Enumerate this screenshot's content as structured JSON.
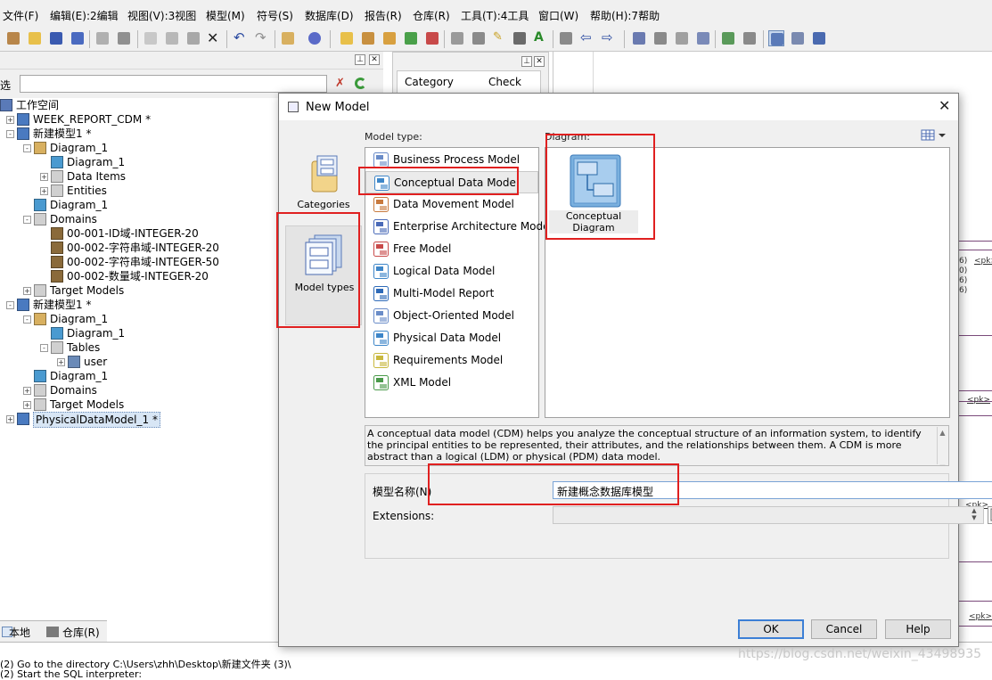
{
  "menu": [
    "文件(F)",
    "编辑(E):2编辑",
    "视图(V):3视图",
    "模型(M)",
    "符号(S)",
    "数据库(D)",
    "报告(R)",
    "仓库(R)",
    "工具(T):4工具",
    "窗口(W)",
    "帮助(H):7帮助"
  ],
  "browser": {
    "filter_label": "选",
    "tree": [
      {
        "label": "工作空间",
        "icon": "workspace-icon"
      },
      {
        "label": "WEEK_REPORT_CDM *",
        "icon": "model-icon"
      },
      {
        "label": "新建模型1 *",
        "icon": "model-icon"
      },
      {
        "label": "Diagram_1",
        "icon": "package-icon"
      },
      {
        "label": "Diagram_1",
        "icon": "diagram-icon"
      },
      {
        "label": "Data Items",
        "icon": "folder-icon"
      },
      {
        "label": "Entities",
        "icon": "folder-icon"
      },
      {
        "label": "Diagram_1",
        "icon": "diagram-icon"
      },
      {
        "label": "Domains",
        "icon": "folder-icon"
      },
      {
        "label": "00-001-ID域-INTEGER-20",
        "icon": "domain-icon"
      },
      {
        "label": "00-002-字符串域-INTEGER-20",
        "icon": "domain-icon"
      },
      {
        "label": "00-002-字符串域-INTEGER-50",
        "icon": "domain-icon"
      },
      {
        "label": "00-002-数量域-INTEGER-20",
        "icon": "domain-icon"
      },
      {
        "label": "Target Models",
        "icon": "folder-icon"
      },
      {
        "label": "新建模型1 *",
        "icon": "model-icon"
      },
      {
        "label": "Diagram_1",
        "icon": "package-icon"
      },
      {
        "label": "Diagram_1",
        "icon": "diagram-icon"
      },
      {
        "label": "Tables",
        "icon": "folder-icon"
      },
      {
        "label": "user",
        "icon": "table-icon"
      },
      {
        "label": "Diagram_1",
        "icon": "diagram-icon"
      },
      {
        "label": "Domains",
        "icon": "folder-icon"
      },
      {
        "label": "Target Models",
        "icon": "folder-icon"
      },
      {
        "label": "PhysicalDataModel_1 *",
        "icon": "model-icon"
      }
    ],
    "tabs": [
      "本地",
      "仓库(R)"
    ]
  },
  "midpanel": {
    "col1": "Category",
    "col2": "Check"
  },
  "output": [
    "(2) Go to the directory C:\\Users\\zhh\\Desktop\\新建文件夹 (3)\\",
    "(2) Start the SQL interpreter:"
  ],
  "diagram_fragments": [
    "6)",
    "<pk>",
    "0)",
    "6)",
    "6)",
    "<pk>",
    "<pk>",
    "<pk>"
  ],
  "dialog": {
    "title": "New Model",
    "categories": [
      {
        "label": "Categories",
        "icon": "categories-icon"
      },
      {
        "label": "Model types",
        "icon": "model-types-icon"
      }
    ],
    "model_type_label": "Model type:",
    "diagram_label": "Diagram:",
    "model_types": [
      {
        "label": "Business Process Model",
        "icon": "bpm-icon",
        "color": "#6a8cc8"
      },
      {
        "label": "Conceptual Data Model",
        "icon": "cdm-icon",
        "color": "#3e86c8"
      },
      {
        "label": "Data Movement Model",
        "icon": "dmm-icon",
        "color": "#c87a3e"
      },
      {
        "label": "Enterprise Architecture Model",
        "icon": "eam-icon",
        "color": "#4a6ab8"
      },
      {
        "label": "Free Model",
        "icon": "free-model-icon",
        "color": "#c84a4a"
      },
      {
        "label": "Logical Data Model",
        "icon": "ldm-icon",
        "color": "#3e86c8"
      },
      {
        "label": "Multi-Model Report",
        "icon": "report-icon",
        "color": "#2e6ab8"
      },
      {
        "label": "Object-Oriented Model",
        "icon": "oom-icon",
        "color": "#6a8cc8"
      },
      {
        "label": "Physical Data Model",
        "icon": "pdm-icon",
        "color": "#3e86c8"
      },
      {
        "label": "Requirements Model",
        "icon": "requirements-icon",
        "color": "#c8b83e"
      },
      {
        "label": "XML Model",
        "icon": "xml-icon",
        "color": "#4a9a4a"
      }
    ],
    "selected_model_type": "Conceptual Data Model",
    "diagram_item": "Conceptual Diagram",
    "description": "A conceptual data model (CDM) helps you analyze the conceptual structure of an information system, to identify the principal entities to be represented, their attributes, and the relationships between them. A CDM is more abstract than a logical (LDM) or physical (PDM) data model.",
    "name_label": "模型名称(N)",
    "name_value": "新建概念数据库模型",
    "extensions_label": "Extensions:",
    "buttons": {
      "ok": "OK",
      "cancel": "Cancel",
      "help": "Help"
    }
  },
  "watermark": "https://blog.csdn.net/weixin_43498935",
  "annotation_color": "#e02020"
}
